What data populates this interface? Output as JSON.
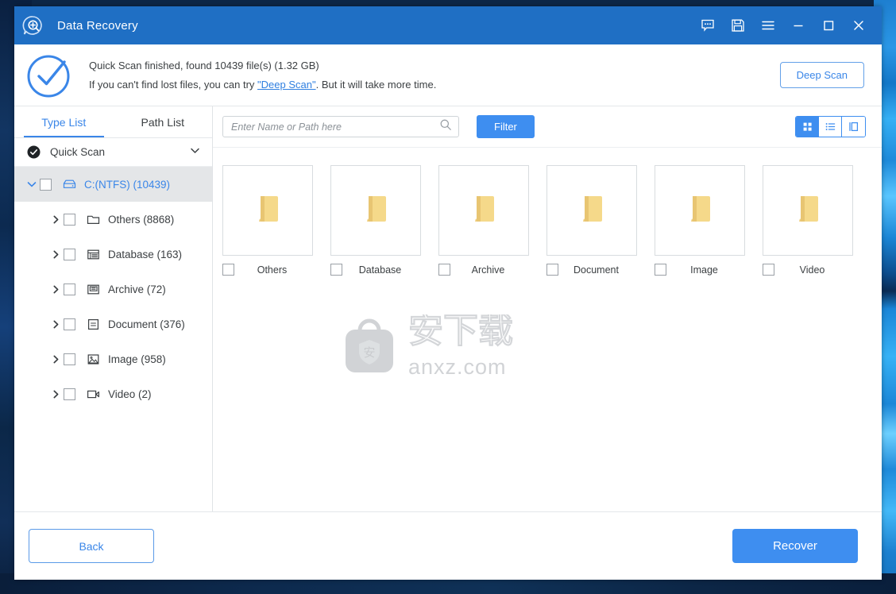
{
  "window": {
    "title": "Data Recovery",
    "logo_icon": "search-bubble-icon",
    "controls": [
      {
        "name": "feedback-icon",
        "glyph": "chat"
      },
      {
        "name": "save-icon",
        "glyph": "floppy"
      },
      {
        "name": "menu-icon",
        "glyph": "hamburger"
      },
      {
        "name": "minimize-icon",
        "glyph": "minimize"
      },
      {
        "name": "maximize-icon",
        "glyph": "maximize"
      },
      {
        "name": "close-icon",
        "glyph": "close"
      }
    ]
  },
  "status": {
    "icon": "check-circle-icon",
    "line1": "Quick Scan finished, found 10439 file(s) (1.32 GB)",
    "line2_before": "If you can't find lost files, you can try ",
    "line2_link": "\"Deep Scan\"",
    "line2_after": ". But it will take more time.",
    "deep_scan_button": "Deep Scan"
  },
  "sidebar": {
    "tabs": [
      {
        "label": "Type List",
        "active": true
      },
      {
        "label": "Path List",
        "active": false
      }
    ],
    "scan_row": {
      "label": "Quick Scan",
      "icon": "check-filled-icon",
      "chevron": "chevron-down-icon"
    },
    "root": {
      "label": "C:(NTFS) (10439)",
      "icon": "drive-icon",
      "expanded": true,
      "checked": false
    },
    "items": [
      {
        "label": "Others (8868)",
        "icon": "folder-icon",
        "checked": false
      },
      {
        "label": "Database (163)",
        "icon": "database-icon",
        "checked": false
      },
      {
        "label": "Archive (72)",
        "icon": "archive-icon",
        "checked": false
      },
      {
        "label": "Document (376)",
        "icon": "document-icon",
        "checked": false
      },
      {
        "label": "Image (958)",
        "icon": "image-icon",
        "checked": false
      },
      {
        "label": "Video (2)",
        "icon": "video-icon",
        "checked": false
      }
    ]
  },
  "toolbar": {
    "search_placeholder": "Enter Name or Path here",
    "search_value": "",
    "search_icon": "search-icon",
    "filter_label": "Filter",
    "views": [
      {
        "name": "grid-view",
        "icon": "grid-icon",
        "active": true
      },
      {
        "name": "list-view",
        "icon": "list-icon",
        "active": false
      },
      {
        "name": "preview-view",
        "icon": "preview-pane-icon",
        "active": false
      }
    ]
  },
  "grid": {
    "items": [
      {
        "label": "Others",
        "icon": "folder-icon",
        "checked": false
      },
      {
        "label": "Database",
        "icon": "folder-icon",
        "checked": false
      },
      {
        "label": "Archive",
        "icon": "folder-icon",
        "checked": false
      },
      {
        "label": "Document",
        "icon": "folder-icon",
        "checked": false
      },
      {
        "label": "Image",
        "icon": "folder-icon",
        "checked": false
      },
      {
        "label": "Video",
        "icon": "folder-icon",
        "checked": false
      }
    ]
  },
  "watermark": {
    "cjk": "安下载",
    "domain": "anxz.com",
    "badge_char": "安"
  },
  "footer": {
    "back_label": "Back",
    "recover_label": "Recover"
  },
  "colors": {
    "titlebar": "#1f6fc4",
    "accent": "#3e8ef0",
    "link": "#2f7fe0",
    "folder": "#f3d077",
    "selected_row": "#e4e6e8"
  }
}
